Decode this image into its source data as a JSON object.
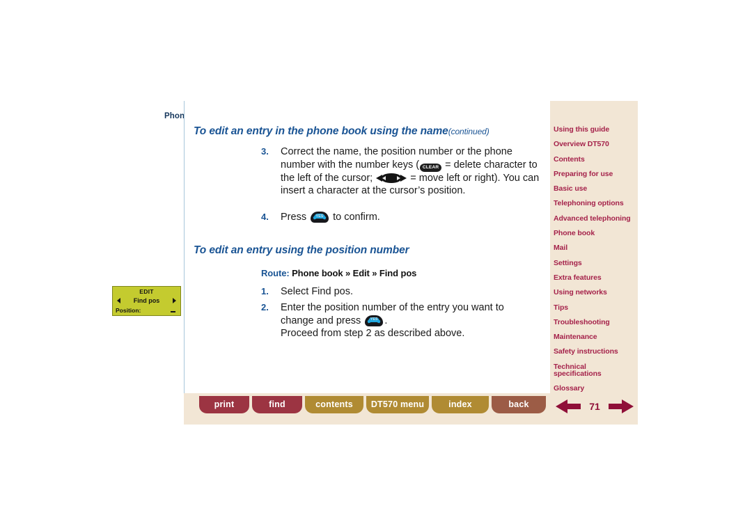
{
  "breadcrumb": "Phone book",
  "headings": {
    "title1": "To edit an entry in the phone book using the name",
    "title1_suffix": "(continued)",
    "title2": "To edit an entry using the position number"
  },
  "route": {
    "label": "Route:",
    "path": "Phone book » Edit » Find pos"
  },
  "steps": {
    "step3": {
      "num": "3.",
      "part1": "Correct the name, the position number or the phone number with the number keys (",
      "key_clear": "CLEAR",
      "part2": " = delete character to the left of the cursor; ",
      "part3": " = move left or right). You can insert a character at the cursor’s position."
    },
    "step4": {
      "num": "4.",
      "part1": "Press ",
      "key_yes": "YES",
      "part2": " to confirm."
    },
    "step_a1": {
      "num": "1.",
      "text": "Select Find pos."
    },
    "step_a2": {
      "num": "2.",
      "part1": "Enter the position number of the entry you want to change and press ",
      "key_yes": "YES",
      "part2": ".",
      "part3": "Proceed from step 2 as described above."
    }
  },
  "display": {
    "title": "EDIT",
    "middle": "Find pos",
    "bottom": "Position:"
  },
  "sidebar": {
    "items": [
      {
        "label": "Using this guide"
      },
      {
        "label": "Overview DT570"
      },
      {
        "label": "Contents"
      },
      {
        "label": "Preparing for use"
      },
      {
        "label": "Basic use"
      },
      {
        "label": "Telephoning options"
      },
      {
        "label": "Advanced telephoning"
      },
      {
        "label": "Phone book"
      },
      {
        "label": "Mail"
      },
      {
        "label": "Settings"
      },
      {
        "label": "Extra features"
      },
      {
        "label": "Using networks"
      },
      {
        "label": "Tips"
      },
      {
        "label": "Troubleshooting"
      },
      {
        "label": "Maintenance"
      },
      {
        "label": "Safety instructions"
      },
      {
        "label": "Technical",
        "label2": "specifications"
      },
      {
        "label": "Glossary"
      }
    ]
  },
  "toolbar": {
    "print": "print",
    "find": "find",
    "contents": "contents",
    "dt570_menu": "DT570 menu",
    "index": "index",
    "back": "back"
  },
  "pager": {
    "page_number": "71"
  },
  "colors": {
    "heading_blue": "#1a5494",
    "breadcrumb_blue": "#15375c",
    "sidebar_bg": "#f2e6d5",
    "sidebar_text": "#a5234b",
    "btn_red": "#9c3442",
    "btn_gold": "#b08b33",
    "btn_brown": "#9c5c46",
    "arrow_maroon": "#8f0f38",
    "display_bg": "#c4cb2f"
  }
}
